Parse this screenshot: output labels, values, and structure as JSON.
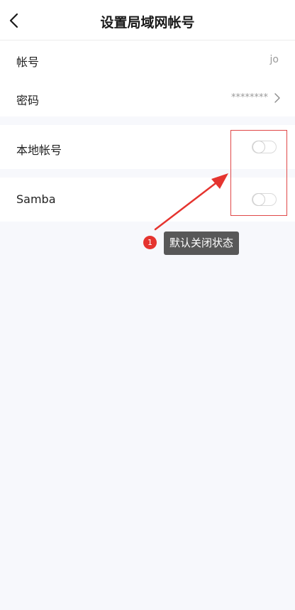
{
  "header": {
    "title": "设置局域网帐号",
    "back_icon": "chevron-left-icon"
  },
  "account": {
    "label": "帐号",
    "value": "jo"
  },
  "password": {
    "label": "密码",
    "value": "********",
    "chevron_icon": "chevron-right-icon"
  },
  "local_account": {
    "label": "本地帐号",
    "toggle_on": false
  },
  "samba": {
    "label": "Samba",
    "toggle_on": false
  },
  "annotation": {
    "badge": "1",
    "text": "默认关闭状态",
    "color": "#e5342f"
  },
  "colors": {
    "background": "#f7f8fc",
    "card": "#ffffff",
    "tooltip": "#585858"
  }
}
